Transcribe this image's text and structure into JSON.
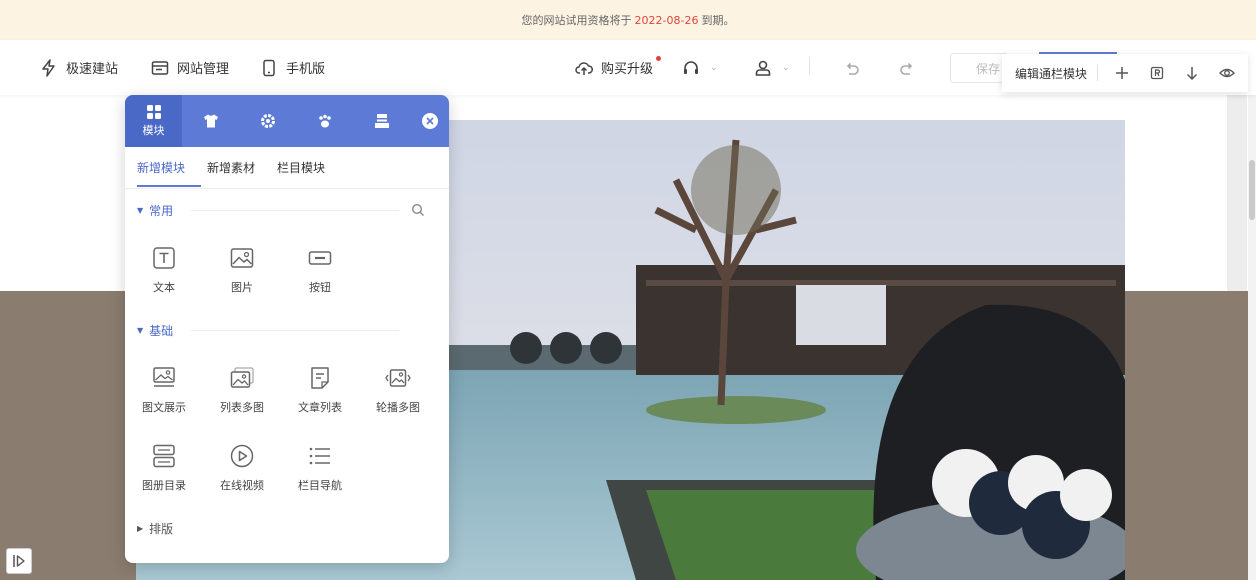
{
  "banner": {
    "prefix": "您的网站试用资格将于",
    "date": "2022-08-26",
    "suffix": "到期。"
  },
  "toolbar": {
    "quick_build": "极速建站",
    "site_manage": "网站管理",
    "mobile": "手机版",
    "buy_upgrade": "购买升级",
    "save": "保存"
  },
  "edit_bar": {
    "label": "编辑通栏模块"
  },
  "panel": {
    "tabs": [
      {
        "label": "模块",
        "icon": "grid-icon"
      },
      {
        "label": "",
        "icon": "shirt-icon"
      },
      {
        "label": "",
        "icon": "gear-icon"
      },
      {
        "label": "",
        "icon": "paw-icon"
      },
      {
        "label": "",
        "icon": "layout-icon"
      }
    ],
    "subtabs": [
      "新增模块",
      "新增素材",
      "栏目模块"
    ],
    "sections": {
      "common": {
        "title": "常用",
        "items": [
          "文本",
          "图片",
          "按钮"
        ]
      },
      "basic": {
        "title": "基础",
        "items": [
          "图文展示",
          "列表多图",
          "文章列表",
          "轮播多图",
          "图册目录",
          "在线视频",
          "栏目导航"
        ]
      },
      "layout": {
        "title": "排版"
      }
    }
  },
  "colors": {
    "accent": "#5d7bd6",
    "banner_bg": "#fdf3e3",
    "band": "#8a7d6f",
    "alert": "#e2453c"
  }
}
